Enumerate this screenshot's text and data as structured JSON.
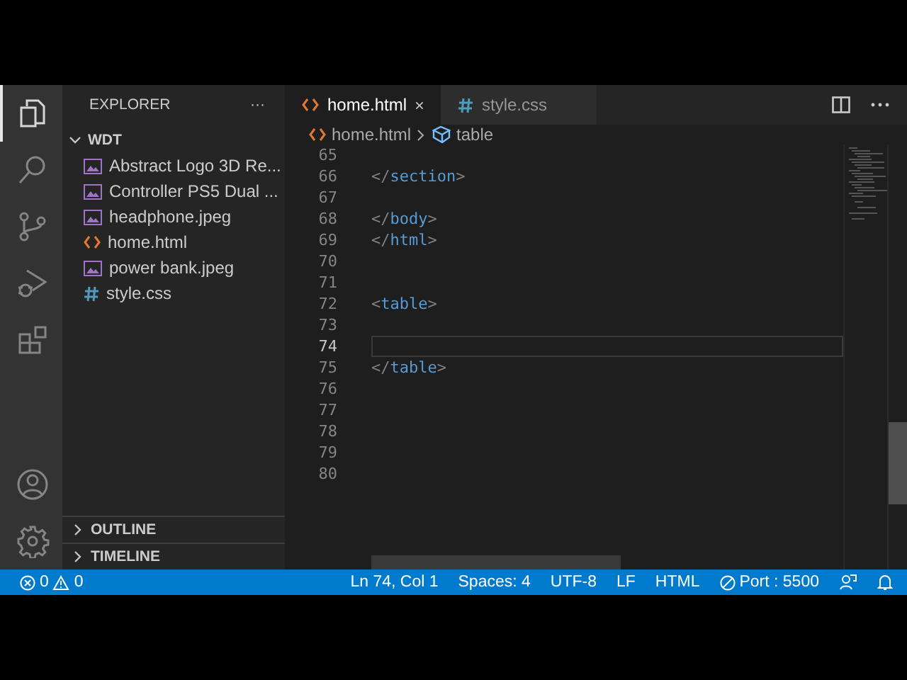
{
  "activity_bar": {
    "items": [
      {
        "kind": "explorer",
        "selected": true
      },
      {
        "kind": "search",
        "selected": false
      },
      {
        "kind": "source-control",
        "selected": false
      },
      {
        "kind": "run-debug",
        "selected": false
      },
      {
        "kind": "extensions",
        "selected": false
      }
    ],
    "bottom": [
      {
        "kind": "account"
      },
      {
        "kind": "settings"
      }
    ]
  },
  "sidebar": {
    "title": "EXPLORER",
    "more": "···",
    "folder": {
      "name": "WDT",
      "expanded": true,
      "files": [
        {
          "name": "Abstract Logo 3D Re...",
          "kind": "image"
        },
        {
          "name": "Controller PS5 Dual ...",
          "kind": "image"
        },
        {
          "name": "headphone.jpeg",
          "kind": "image"
        },
        {
          "name": "home.html",
          "kind": "html"
        },
        {
          "name": "power bank.jpeg",
          "kind": "image"
        },
        {
          "name": "style.css",
          "kind": "css"
        }
      ]
    },
    "panels": [
      {
        "name": "OUTLINE",
        "expanded": false
      },
      {
        "name": "TIMELINE",
        "expanded": false
      }
    ]
  },
  "tabs": [
    {
      "label": "home.html",
      "kind": "html",
      "selected": true
    },
    {
      "label": "style.css",
      "kind": "css",
      "selected": false
    }
  ],
  "breadcrumbs": [
    {
      "label": "home.html",
      "kind": "html"
    },
    {
      "label": "table",
      "kind": "symbol"
    }
  ],
  "editor": {
    "lines": [
      {
        "number": "65",
        "current": false
      },
      {
        "number": "66",
        "current": false,
        "tokens": [
          {
            "kind": "punct",
            "text": "</"
          },
          {
            "kind": "tag",
            "text": "section"
          },
          {
            "kind": "punct",
            "text": ">"
          }
        ]
      },
      {
        "number": "67",
        "current": false
      },
      {
        "number": "68",
        "current": false,
        "tokens": [
          {
            "kind": "punct",
            "text": "</"
          },
          {
            "kind": "tag",
            "text": "body"
          },
          {
            "kind": "punct",
            "text": ">"
          }
        ]
      },
      {
        "number": "69",
        "current": false,
        "tokens": [
          {
            "kind": "punct",
            "text": "</"
          },
          {
            "kind": "tag",
            "text": "html"
          },
          {
            "kind": "punct",
            "text": ">"
          }
        ]
      },
      {
        "number": "70",
        "current": false
      },
      {
        "number": "71",
        "current": false
      },
      {
        "number": "72",
        "current": false,
        "tokens": [
          {
            "kind": "punct",
            "text": "<"
          },
          {
            "kind": "tag",
            "text": "table"
          },
          {
            "kind": "punct",
            "text": ">"
          }
        ]
      },
      {
        "number": "73",
        "current": false
      },
      {
        "number": "74",
        "current": true
      },
      {
        "number": "75",
        "current": false,
        "tokens": [
          {
            "kind": "punct",
            "text": "</"
          },
          {
            "kind": "tag",
            "text": "table"
          },
          {
            "kind": "punct",
            "text": ">"
          }
        ]
      },
      {
        "number": "76",
        "current": false
      },
      {
        "number": "77",
        "current": false
      },
      {
        "number": "78",
        "current": false
      },
      {
        "number": "79",
        "current": false
      },
      {
        "number": "80",
        "current": false
      }
    ]
  },
  "status_bar": {
    "errors": "0",
    "warnings": "0",
    "items": [
      "Ln 74, Col 1",
      "Spaces: 4",
      "UTF-8",
      "LF",
      "HTML"
    ],
    "port": "Port : 5500"
  }
}
